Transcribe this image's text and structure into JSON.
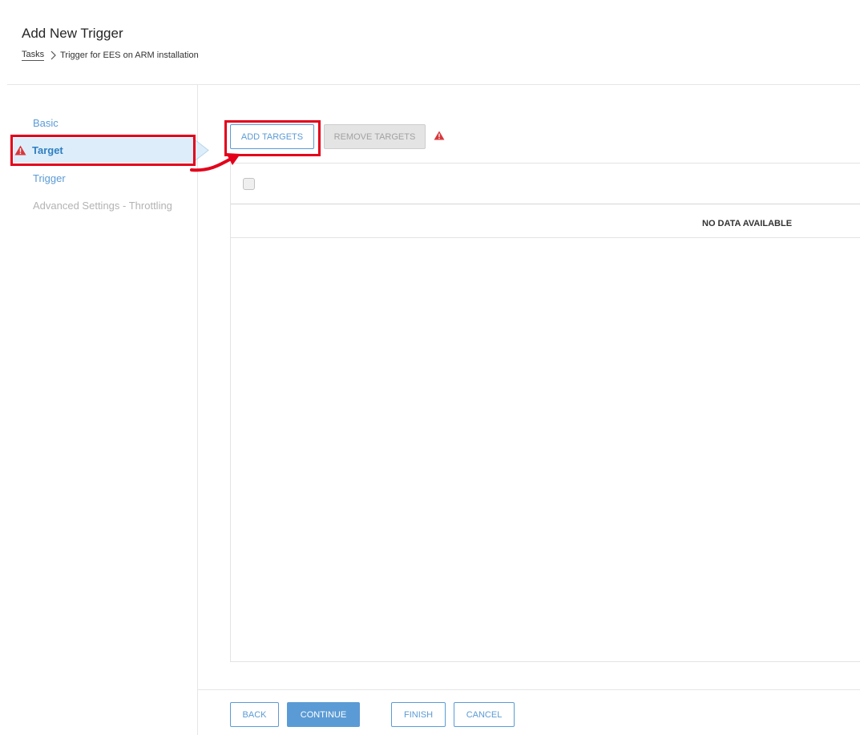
{
  "page": {
    "title": "Add New Trigger"
  },
  "breadcrumb": {
    "root": "Tasks",
    "current": "Trigger for EES on ARM installation"
  },
  "steps": {
    "basic": "Basic",
    "target": "Target",
    "trigger": "Trigger",
    "advanced": "Advanced Settings - Throttling",
    "active": "target",
    "target_has_warning": true
  },
  "toolbar": {
    "add_label": "ADD TARGETS",
    "remove_label": "REMOVE TARGETS",
    "remove_disabled": true,
    "warning_icon": "warning-triangle-icon"
  },
  "grid": {
    "select_all_checked": false,
    "empty_text": "NO DATA AVAILABLE"
  },
  "footer": {
    "back_label": "BACK",
    "continue_label": "CONTINUE",
    "finish_label": "FINISH",
    "cancel_label": "CANCEL"
  },
  "colors": {
    "accent": "#5b9bd5",
    "warning": "#d9373b",
    "highlight": "#e3001b",
    "active_step_bg": "#ddeefa"
  }
}
